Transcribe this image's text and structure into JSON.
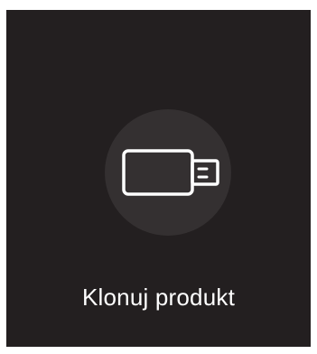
{
  "tile": {
    "label": "Klonuj produkt",
    "icon": "usb-drive-icon",
    "background_color": "#231f20",
    "circle_color": "#343031",
    "foreground_color": "#ffffff"
  }
}
